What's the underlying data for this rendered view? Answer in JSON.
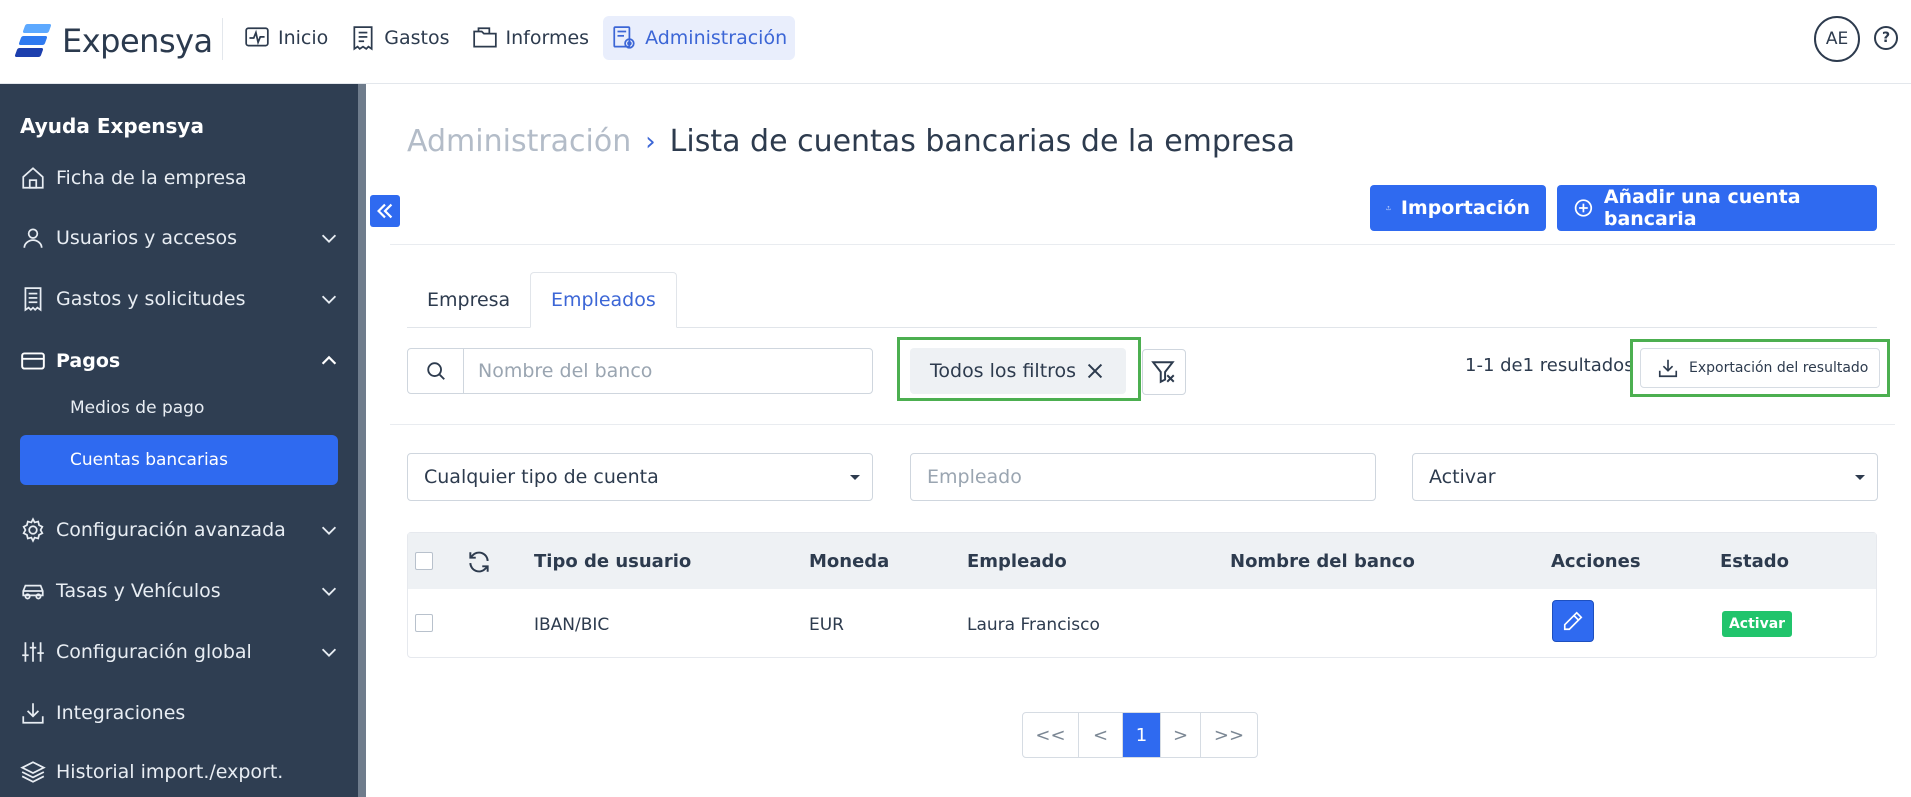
{
  "app": {
    "name": "Expensya",
    "user_initials": "AE",
    "help_label": "?"
  },
  "nav": [
    {
      "label": "Inicio",
      "icon": "activity-icon"
    },
    {
      "label": "Gastos",
      "icon": "receipt-icon"
    },
    {
      "label": "Informes",
      "icon": "folder-icon"
    },
    {
      "label": "Administración",
      "icon": "admin-settings-icon",
      "active": true
    }
  ],
  "sidebar": {
    "title": "Ayuda Expensya",
    "items": [
      {
        "label": "Ficha de la empresa"
      },
      {
        "label": "Usuarios y accesos"
      },
      {
        "label": "Gastos y solicitudes"
      },
      {
        "label": "Pagos",
        "expanded": true
      },
      {
        "label": "Configuración avanzada"
      },
      {
        "label": "Tasas y Vehículos"
      },
      {
        "label": "Configuración global"
      },
      {
        "label": "Integraciones"
      },
      {
        "label": "Historial import./export."
      }
    ],
    "pagos_sub": [
      {
        "label": "Medios de pago"
      },
      {
        "label": "Cuentas bancarias",
        "active": true
      }
    ]
  },
  "breadcrumb": {
    "parent": "Administración",
    "separator": "›",
    "current": "Lista de cuentas bancarias de la empresa"
  },
  "actions": {
    "import_label": "Importación",
    "add_label": "Añadir una cuenta bancaria"
  },
  "tabs": [
    {
      "label": "Empresa"
    },
    {
      "label": "Empleados",
      "active": true
    }
  ],
  "filters": {
    "search_placeholder": "Nombre del banco",
    "chip_label": "Todos los filtros",
    "result_count": "1-1 de1 resultados",
    "export_label": "Exportación del resultado",
    "account_type_value": "Cualquier tipo de cuenta",
    "employee_placeholder": "Empleado",
    "status_value": "Activar"
  },
  "table": {
    "columns": [
      "Tipo de usuario",
      "Moneda",
      "Empleado",
      "Nombre del banco",
      "Acciones",
      "Estado"
    ],
    "rows": [
      {
        "tipo": "IBAN/BIC",
        "moneda": "EUR",
        "empleado": "Laura Francisco",
        "banco": "",
        "estado": "Activar"
      }
    ]
  },
  "pagination": {
    "first": "<<",
    "prev": "<",
    "current": "1",
    "next": ">",
    "last": ">>"
  },
  "colors": {
    "primary": "#2f6af0",
    "sidebar": "#2f3e52",
    "success": "#21c46c",
    "highlight": "#4caf50"
  }
}
